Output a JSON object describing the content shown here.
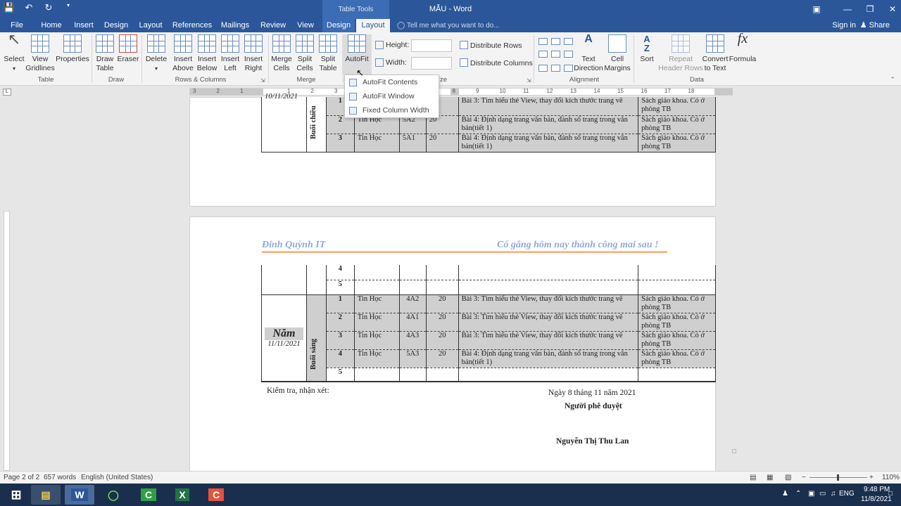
{
  "titlebar": {
    "doc_title": "MẪU - Word",
    "context_tab_group": "Table Tools"
  },
  "tabs": [
    "File",
    "Home",
    "Insert",
    "Design",
    "Layout",
    "References",
    "Mailings",
    "Review",
    "View",
    "Design",
    "Layout"
  ],
  "tellme_placeholder": "Tell me what you want to do...",
  "account": {
    "signin": "Sign in",
    "share": "Share"
  },
  "ribbon": {
    "select": "Select",
    "view_gridlines": [
      "View",
      "Gridlines"
    ],
    "properties": "Properties",
    "draw_table": [
      "Draw",
      "Table"
    ],
    "eraser": "Eraser",
    "delete": "Delete",
    "insert_above": [
      "Insert",
      "Above"
    ],
    "insert_below": [
      "Insert",
      "Below"
    ],
    "insert_left": [
      "Insert",
      "Left"
    ],
    "insert_right": [
      "Insert",
      "Right"
    ],
    "merge_cells": [
      "Merge",
      "Cells"
    ],
    "split_cells": [
      "Split",
      "Cells"
    ],
    "split_table": [
      "Split",
      "Table"
    ],
    "autofit": "AutoFit",
    "height_label": "Height:",
    "width_label": "Width:",
    "distribute_rows": "Distribute Rows",
    "distribute_columns": "Distribute Columns",
    "text_direction": [
      "Text",
      "Direction"
    ],
    "cell_margins": [
      "Cell",
      "Margins"
    ],
    "sort": "Sort",
    "repeat_header_rows": [
      "Repeat",
      "Header Rows"
    ],
    "convert_to_text": [
      "Convert",
      "to Text"
    ],
    "formula": "Formula",
    "groups": {
      "table": "Table",
      "draw": "Draw",
      "rows_columns": "Rows & Columns",
      "merge": "Merge",
      "size_partial": "ze",
      "alignment": "Alignment",
      "data": "Data"
    }
  },
  "autofit_menu": [
    "AutoFit Contents",
    "AutoFit Window",
    "Fixed Column Width"
  ],
  "page1": {
    "date_partial": "10/11/2021",
    "session": "Buổi chiều",
    "rows": [
      {
        "num": "1",
        "subject": "",
        "class": "",
        "period": "20",
        "lesson": "Bài 3: Tìm hiểu thẻ View, thay đổi kích thước trang vẽ",
        "note": "Sách giáo khoa. Có ở phòng TB"
      },
      {
        "num": "2",
        "subject": "Tin Học",
        "class": "5A2",
        "period": "20",
        "lesson": "Bài 4: Định dạng trang văn bản, đánh số trang trong văn bản(tiết 1)",
        "note": "Sách giáo khoa. Có ở phòng TB"
      },
      {
        "num": "3",
        "subject": "Tin Học",
        "class": "5A1",
        "period": "20",
        "lesson": "Bài 4: Định dạng trang văn bản, đánh số trang trong văn bản(tiết 1)",
        "note": "Sách giáo khoa. Có ở phòng TB"
      }
    ]
  },
  "page2": {
    "header_left": "Đinh Quỳnh IT",
    "header_right": "Cố gắng hôm nay thành công mai sau !",
    "cont_rows": [
      "4",
      "5"
    ],
    "day": "Năm",
    "date": "11/11/2021",
    "session": "Buổi sáng",
    "rows": [
      {
        "num": "1",
        "subject": "Tin Học",
        "class": "4A2",
        "period": "20",
        "lesson": "Bài 3: Tìm hiểu thẻ View, thay đổi kích thước trang vẽ",
        "note": "Sách giáo khoa. Có ở phòng TB"
      },
      {
        "num": "2",
        "subject": "Tin Học",
        "class": "4A1",
        "period": "20",
        "lesson": "Bài 3: Tìm hiểu thẻ View, thay đổi kích thước trang vẽ",
        "note": "Sách giáo khoa. Có ở phòng TB"
      },
      {
        "num": "3",
        "subject": "Tin Học",
        "class": "4A3",
        "period": "20",
        "lesson": "Bài 3: Tìm hiểu thẻ View, thay đổi kích thước trang vẽ",
        "note": "Sách giáo khoa. Có ở phòng TB"
      },
      {
        "num": "4",
        "subject": "Tin Học",
        "class": "5A3",
        "period": "20",
        "lesson": "Bài 4: Định dạng trang văn bản, đánh số trang trong văn bản(tiết 1)",
        "note": "Sách giáo khoa. Có ở phòng TB"
      },
      {
        "num": "5",
        "subject": "",
        "class": "",
        "period": "",
        "lesson": "",
        "note": ""
      }
    ],
    "check_label": "Kiểm tra, nhận xét:",
    "date_line": "Ngày 8 tháng 11 năm 2021",
    "approver_title": "Người phê duyệt",
    "approver_name": "Nguyễn Thị Thu Lan"
  },
  "status": {
    "page": "Page 2 of 2",
    "words": "657 words",
    "language": "English (United States)",
    "zoom": "110%"
  },
  "tray": {
    "lang": "ENG",
    "time": "9:48 PM",
    "date": "11/8/2021"
  }
}
